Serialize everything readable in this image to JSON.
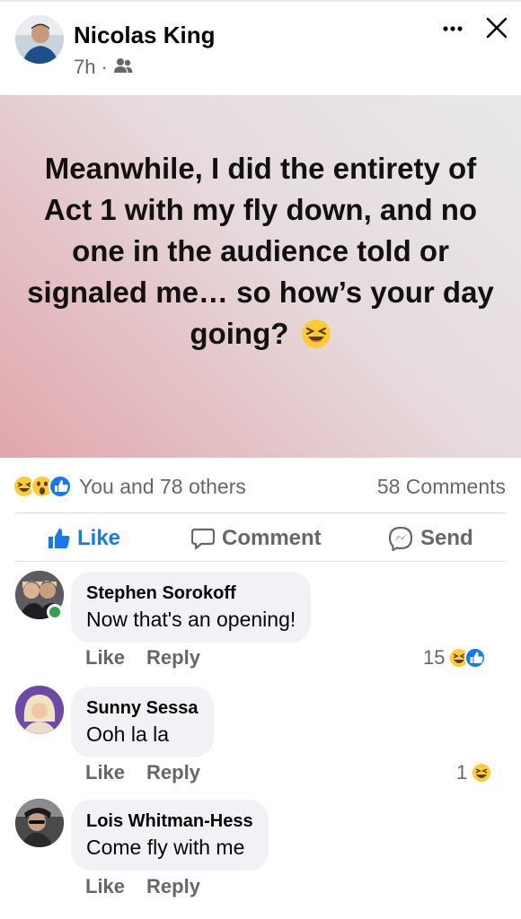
{
  "colors": {
    "brand_blue": "#1877f2",
    "muted": "#65676b",
    "bubble": "#f0f2f5",
    "online": "#31a24c"
  },
  "post": {
    "author": "Nicolas King",
    "time": "7h",
    "separator": "·",
    "audience_icon": "friends-icon",
    "more_icon": "more-icon",
    "close_icon": "close-icon",
    "text": "Meanwhile, I did the entirety of Act 1 with my fly down, and no one in the audience told or signaled me… so how’s your day going?",
    "text_emoji": "laughing-face-emoji"
  },
  "reactions": {
    "icons": [
      "haha-icon",
      "wow-icon",
      "like-icon"
    ],
    "summary": "You and 78 others",
    "comments_count": "58 Comments"
  },
  "actions": {
    "like": "Like",
    "comment": "Comment",
    "send": "Send"
  },
  "comments": [
    {
      "author": "Stephen Sorokoff",
      "text": "Now that's an opening!",
      "like": "Like",
      "reply": "Reply",
      "reaction_count": "15",
      "reaction_icons": [
        "haha-icon",
        "like-icon"
      ],
      "online": true
    },
    {
      "author": "Sunny Sessa",
      "text": "Ooh la la",
      "like": "Like",
      "reply": "Reply",
      "reaction_count": "1",
      "reaction_icons": [
        "haha-icon"
      ],
      "online": false
    },
    {
      "author": "Lois Whitman-Hess",
      "text": "Come fly with me",
      "like": "Like",
      "reply": "Reply",
      "reaction_count": "",
      "reaction_icons": [],
      "online": false
    }
  ]
}
